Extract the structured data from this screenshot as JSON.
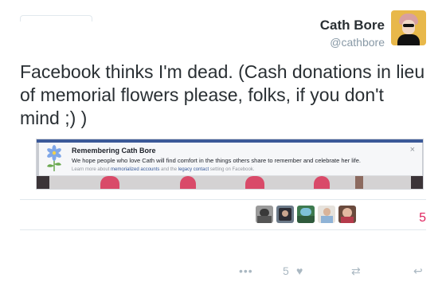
{
  "author": {
    "name": "Cath Bore",
    "handle": "@cathbore"
  },
  "tweet": {
    "text": "Facebook thinks I'm dead. (Cash donations in lieu of memorial flowers please, folks, if you don't mind ;) )"
  },
  "embedded_screenshot": {
    "title": "Remembering Cath Bore",
    "message": "We hope people who love Cath will find comfort in the things others share to remember and celebrate her life.",
    "learn_prefix": "Learn more about ",
    "learn_link1": "memorialized accounts",
    "learn_mid": " and the ",
    "learn_link2": "legacy contact",
    "learn_suffix": " setting on Facebook.",
    "close_symbol": "×",
    "accent_color": "#3b5998"
  },
  "stats": {
    "likes": "5",
    "like_color": "#e0245e",
    "likers": [
      "liker-1",
      "liker-2",
      "liker-3",
      "liker-4",
      "liker-5"
    ]
  },
  "actions": {
    "more_icon": "more-icon",
    "more_symbol": "•••",
    "like_count": "5",
    "like_icon": "heart-icon",
    "like_symbol": "♥",
    "retweet_icon": "retweet-icon",
    "retweet_symbol": "⇄",
    "reply_icon": "reply-icon",
    "reply_symbol": "↩"
  }
}
